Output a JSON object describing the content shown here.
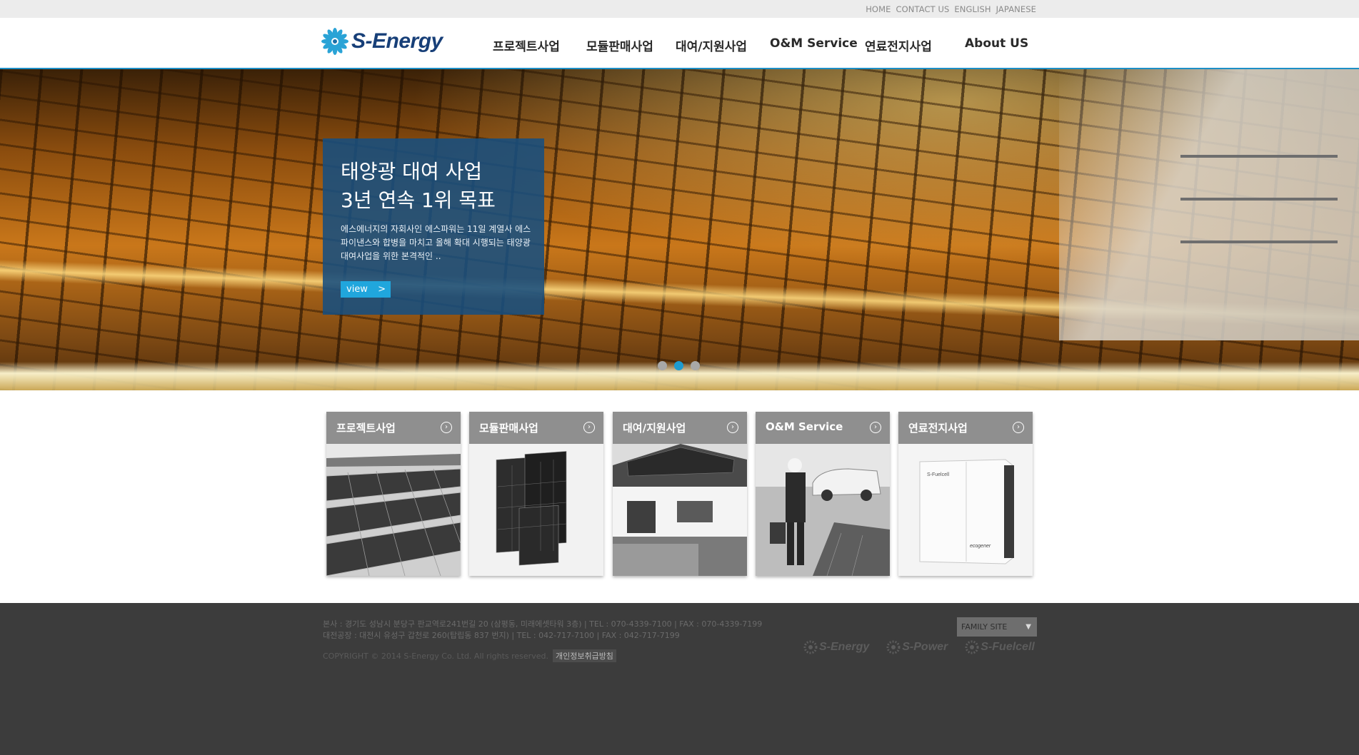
{
  "util_links": [
    "HOME",
    "CONTACT US",
    "ENGLISH",
    "JAPANESE"
  ],
  "brand": {
    "name": "S-Energy"
  },
  "nav": [
    "프로젝트사업",
    "모듈판매사업",
    "대여/지원사업",
    "O&M Service",
    "연료전지사업",
    "About US"
  ],
  "hero": {
    "title_line1": "태양광 대여 사업",
    "title_line2": "3년 연속 1위 목표",
    "desc": "에스에너지의 자회사인 에스파워는 11일 계열사 에스파이낸스와 합병을 마치고 올해 확대 시행되는 태양광 대여사업을 위한 본격적인 ..",
    "view_label": "view",
    "arrow": ">",
    "slides_total": 3,
    "active_slide": 2
  },
  "cards": [
    {
      "title": "프로젝트사업",
      "icon": "arrow-circle-icon"
    },
    {
      "title": "모듈판매사업",
      "icon": "arrow-circle-icon"
    },
    {
      "title": "대여/지원사업",
      "icon": "arrow-circle-icon"
    },
    {
      "title": "O&M Service",
      "icon": "arrow-circle-icon"
    },
    {
      "title": "연료전지사업",
      "icon": "arrow-circle-icon"
    }
  ],
  "fuelcell": {
    "brand": "S-Fuelcell",
    "product": "ecogener"
  },
  "footer": {
    "line1": "본사 : 경기도 성남시 분당구 판교역로241번길 20 (삼평동, 미래에셋타워 3층) | TEL : 070-4339-7100 | FAX : 070-4339-7199",
    "line2": "대전공장 : 대전시 유성구 갑천로 260(탑립동 837 번지) | TEL : 042-717-7100 | FAX : 042-717-7199",
    "copyright": "COPYRIGHT © 2014 S-Energy Co. Ltd. All rights reserved.",
    "privacy": "개인정보취급방침",
    "family_site": "FAMILY SITE",
    "family_logos": [
      "S-Energy",
      "S-Power",
      "S-Fuelcell"
    ]
  },
  "colors": {
    "accent": "#1d8fc6",
    "brand_navy": "#173f78",
    "footer_bg": "#3c3c3c",
    "card_head": "#8f8f8f"
  }
}
